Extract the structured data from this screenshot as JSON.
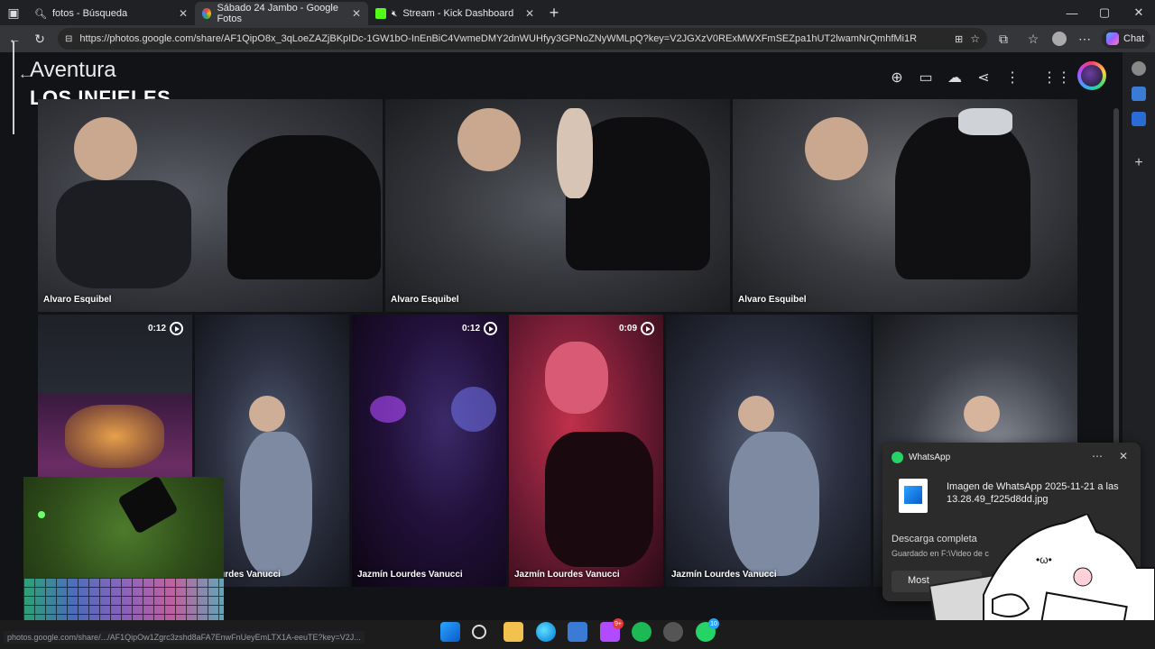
{
  "browser": {
    "tabs": [
      {
        "label": "fotos - Búsqueda",
        "icon": "search-icon",
        "active": false
      },
      {
        "label": "Sábado 24 Jambo - Google Fotos",
        "icon": "google-photos-icon",
        "active": true
      },
      {
        "label": "Stream - Kick Dashboard",
        "icon": "kick-icon",
        "active": false
      }
    ],
    "url": "https://photos.google.com/share/AF1QipO8x_3qLoeZAZjBKpIDc-1GW1bO-InEnBiC4VwmeDMY2dnWUHfyy3GPNoZNyWMLpQ?key=V2JGXzV0RExMWXFmSEZpa1hUT2lwamNrQmhfMi1R",
    "chat_label": "Chat"
  },
  "album": {
    "title": "Aventura",
    "subtitle": "LOS INFIELES"
  },
  "photos_row1": [
    {
      "owner": "Alvaro Esquibel"
    },
    {
      "owner": "Alvaro Esquibel"
    },
    {
      "owner": "Alvaro Esquibel"
    }
  ],
  "photos_row2": [
    {
      "owner": "",
      "duration": "0:12"
    },
    {
      "owner": "n Lourdes Vanucci",
      "duration": ""
    },
    {
      "owner": "Jazmín Lourdes Vanucci",
      "duration": "0:12"
    },
    {
      "owner": "Jazmín Lourdes Vanucci",
      "duration": "0:09"
    },
    {
      "owner": "Jazmín Lourdes Vanucci",
      "duration": ""
    },
    {
      "owner": "",
      "duration": ""
    }
  ],
  "notification": {
    "app": "WhatsApp",
    "file_title": "Imagen de WhatsApp 2025-11-21 a las 13.28.49_f225d8dd.jpg",
    "status": "Descarga completa",
    "saved_to": "Guardado en F:\\Video de c",
    "button_label": "Most"
  },
  "status_bar": {
    "url": "photos.google.com/share/.../AF1QipOw1Zgrc3zshd8aFA7EnwFnUeyEmLTX1A-eeuTE?key=V2J..."
  },
  "taskbar": {
    "discord_badge": "9+",
    "whatsapp_badge": "10"
  },
  "colors": {
    "page_bg": "#121316",
    "browser_bg": "#202124",
    "toolbar_bg": "#35363a",
    "whatsapp_green": "#25d366",
    "kick_green": "#53fc18"
  }
}
